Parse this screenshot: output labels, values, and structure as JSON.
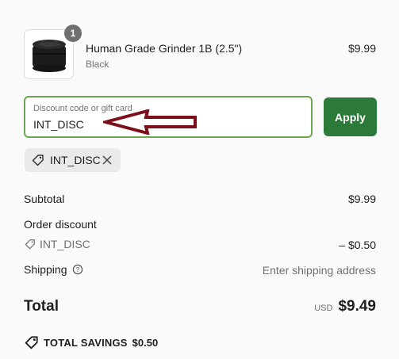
{
  "line_item": {
    "quantity": "1",
    "name": "Human Grade Grinder 1B (2.5\")",
    "variant": "Black",
    "price": "$9.99",
    "icon": "grinder-product-image"
  },
  "discount": {
    "placeholder": "Discount code or gift card",
    "value": "INT_DISC",
    "apply_label": "Apply",
    "annotation_icon": "arrow-left-icon",
    "annotation_color": "#7b0f1a"
  },
  "applied_codes": [
    {
      "code": "INT_DISC",
      "icon": "tag-icon",
      "remove_icon": "close-icon"
    }
  ],
  "summary": {
    "subtotal_label": "Subtotal",
    "subtotal_value": "$9.99",
    "order_discount_label": "Order discount",
    "discount_code": "INT_DISC",
    "discount_value": "– $0.50",
    "shipping_label": "Shipping",
    "shipping_value": "Enter shipping address"
  },
  "total": {
    "label": "Total",
    "currency": "USD",
    "amount": "$9.49"
  },
  "savings": {
    "label": "TOTAL SAVINGS",
    "amount": "$0.50"
  },
  "colors": {
    "accent": "#2c7a3a",
    "field_border": "#6aa84f",
    "muted_text": "#707070"
  }
}
